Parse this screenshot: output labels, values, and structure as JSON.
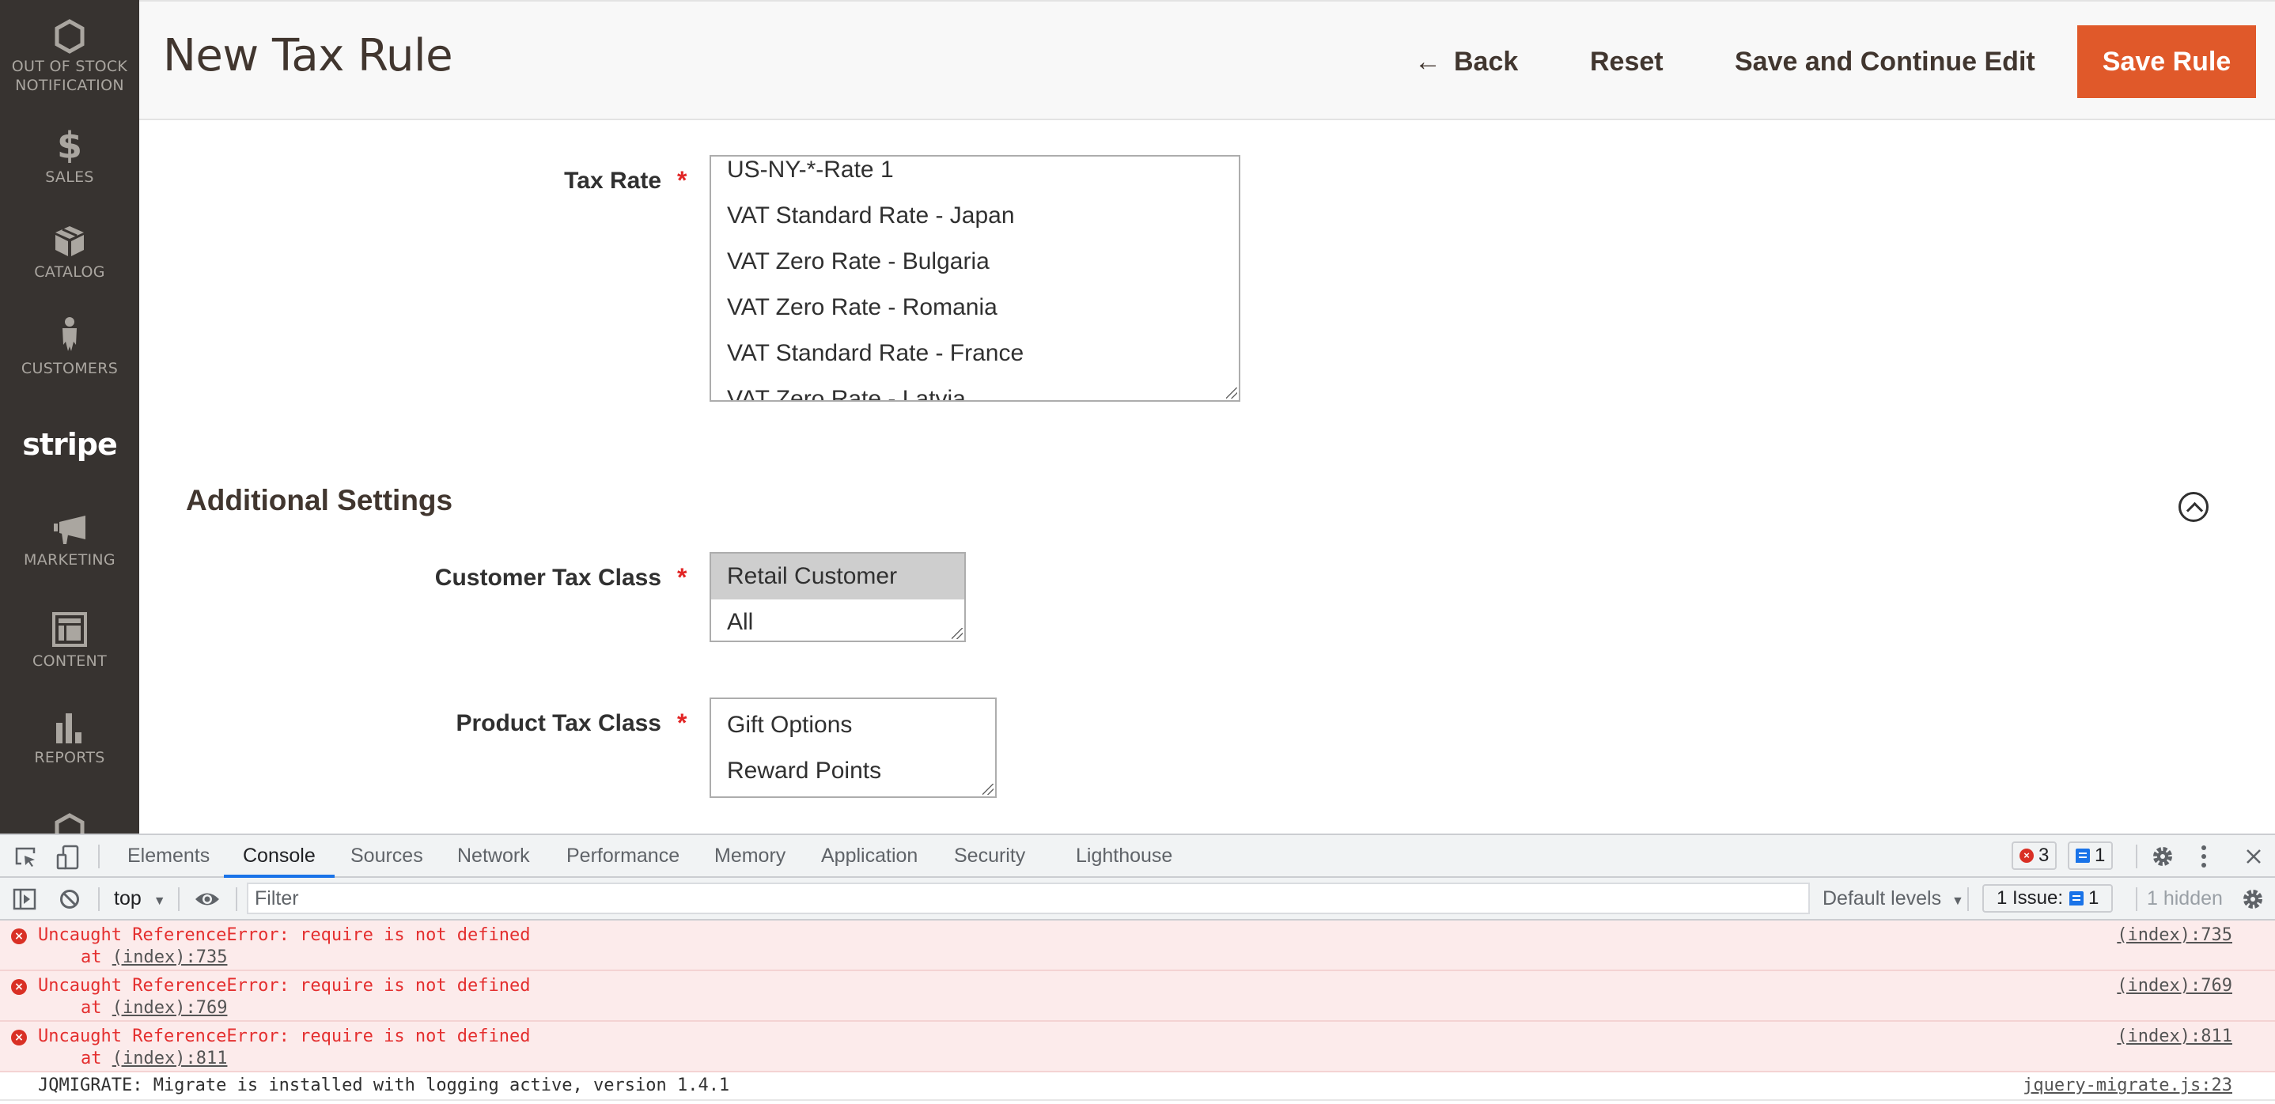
{
  "sidebar": {
    "items": [
      {
        "label_line1": "OUT OF STOCK",
        "label_line2": "NOTIFICATION",
        "icon": "hexagon-icon"
      },
      {
        "label": "SALES",
        "icon": "dollar-icon"
      },
      {
        "label": "CATALOG",
        "icon": "box-icon"
      },
      {
        "label": "CUSTOMERS",
        "icon": "person-icon"
      },
      {
        "label": "stripe",
        "icon": "stripe-logo"
      },
      {
        "label": "MARKETING",
        "icon": "megaphone-icon"
      },
      {
        "label": "CONTENT",
        "icon": "layout-icon"
      },
      {
        "label": "REPORTS",
        "icon": "bar-chart-icon"
      }
    ]
  },
  "header": {
    "title": "New Tax Rule",
    "back_label": "Back",
    "reset_label": "Reset",
    "save_continue_label": "Save and Continue Edit",
    "save_label": "Save Rule",
    "accent_color": "#e0592a"
  },
  "form": {
    "tax_rate": {
      "label": "Tax Rate",
      "required": "*",
      "options": [
        "US-NY-*-Rate 1",
        "VAT Standard Rate - Japan",
        "VAT Zero Rate - Bulgaria",
        "VAT Zero Rate - Romania",
        "VAT Standard Rate - France",
        "VAT Zero Rate - Latvia"
      ]
    },
    "additional_settings": {
      "title": "Additional Settings",
      "customer_tax_class": {
        "label": "Customer Tax Class",
        "required": "*",
        "options": [
          "Retail Customer",
          "All"
        ],
        "selected": "Retail Customer"
      },
      "product_tax_class": {
        "label": "Product Tax Class",
        "required": "*",
        "options": [
          "Gift Options",
          "Reward Points"
        ]
      }
    }
  },
  "devtools": {
    "tabs": [
      "Elements",
      "Console",
      "Sources",
      "Network",
      "Performance",
      "Memory",
      "Application",
      "Security",
      "Lighthouse"
    ],
    "active_tab": "Console",
    "error_count": "3",
    "message_count": "1",
    "context": "top",
    "filter_placeholder": "Filter",
    "levels": "Default levels",
    "issues_label": "1 Issue:",
    "issues_count": "1",
    "hidden_label": "1 hidden",
    "logs": [
      {
        "type": "error",
        "message": "Uncaught ReferenceError: require is not defined",
        "at_prefix": "at ",
        "at_link": "(index):735",
        "source": "(index):735"
      },
      {
        "type": "error",
        "message": "Uncaught ReferenceError: require is not defined",
        "at_prefix": "at ",
        "at_link": "(index):769",
        "source": "(index):769"
      },
      {
        "type": "error",
        "message": "Uncaught ReferenceError: require is not defined",
        "at_prefix": "at ",
        "at_link": "(index):811",
        "source": "(index):811"
      },
      {
        "type": "info",
        "message": "JQMIGRATE: Migrate is installed with logging active, version 1.4.1",
        "source": "jquery-migrate.js:23"
      }
    ]
  }
}
